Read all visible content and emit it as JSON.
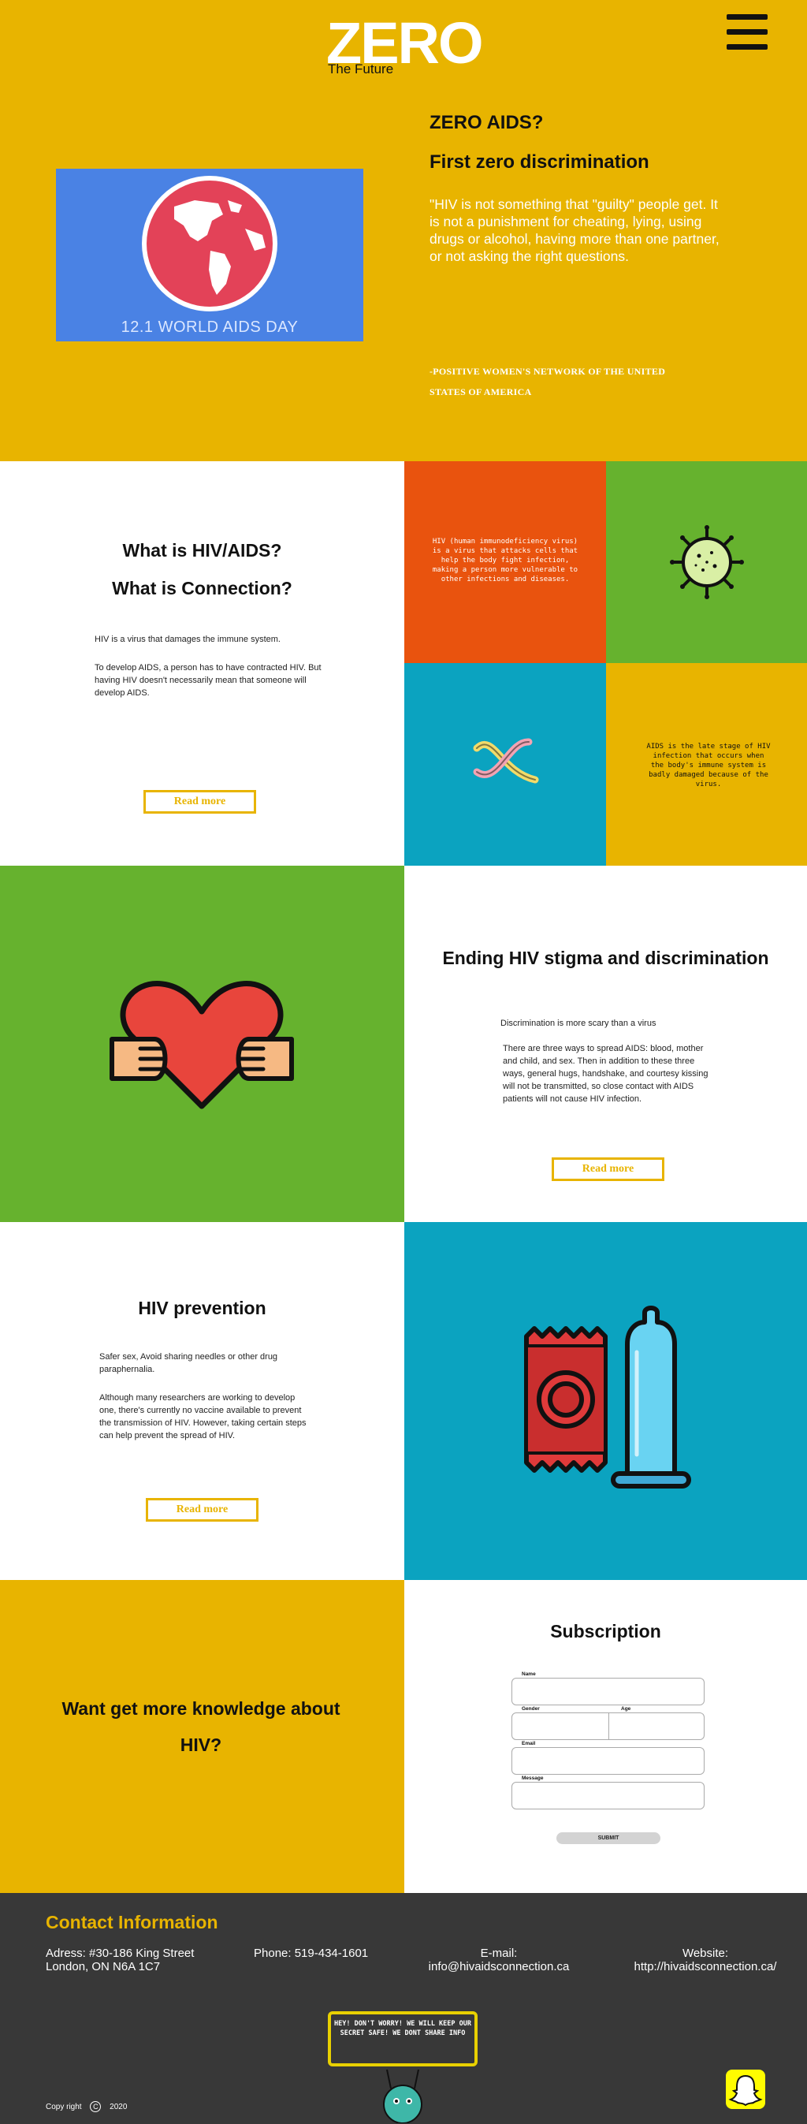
{
  "header": {
    "logo_text": "ZERO",
    "logo_tagline": "The Future",
    "menu_icon": "hamburger-menu-icon"
  },
  "hero": {
    "card_label": "12.1 WORLD AIDS DAY",
    "title_1": "ZERO AIDS?",
    "title_2": "First zero discrimination",
    "quote": "\"HIV is not something that \"guilty\" people get. It is not a punishment for cheating, lying, using drugs or alcohol, having more than one partner, or not asking the right questions.",
    "source": "-POSITIVE WOMEN'S NETWORK OF THE UNITED STATES OF AMERICA"
  },
  "what": {
    "heading_1": "What is HIV/AIDS?",
    "heading_2": "What is Connection?",
    "para_1": "HIV is a virus that damages the immune system.",
    "para_2": "To develop AIDS, a person has to have contracted HIV. But having HIV doesn't necessarily mean that someone will develop AIDS.",
    "read_more": "Read more",
    "tile_hiv_text": "HIV (human immunodeficiency virus) is a virus that attacks cells that help the body fight infection, making a person more vulnerable to other infections and diseases.",
    "tile_aids_text": "AIDS is the late stage of HIV infection that occurs when the body's immune system is badly damaged because of the virus."
  },
  "stigma": {
    "heading": "Ending HIV stigma and discrimination",
    "para_1": "Discrimination is more scary than a virus",
    "para_2": "There are three ways to spread AIDS: blood, mother and child, and sex. Then in addition to these three ways, general hugs, handshake, and courtesy kissing will not be transmitted, so close contact with AIDS patients will not cause HIV infection.",
    "read_more": "Read more"
  },
  "prevention": {
    "heading": "HIV prevention",
    "para_1": "Safer sex, Avoid sharing needles or other drug paraphernalia.",
    "para_2": "Although many researchers are working to develop one, there's currently no vaccine available to prevent the transmission of HIV. However, taking certain steps can help prevent the spread of HIV.",
    "read_more": "Read more"
  },
  "subscription": {
    "question": "Want get more knowledge about HIV?",
    "heading": "Subscription",
    "fields": {
      "name": "Name",
      "gender": "Gender",
      "age": "Age",
      "email": "Email",
      "message": "Message"
    },
    "submit": "SUBMIT"
  },
  "footer": {
    "title": "Contact Information",
    "address": "Adress: #30-186 King Street London, ON N6A 1C7",
    "phone": "Phone: 519-434-1601",
    "email": "E-mail: info@hivaidsconnection.ca",
    "website": "Website: http://hivaidsconnection.ca/",
    "mascot_sign": "HEY! DON'T WORRY! WE WILL KEEP OUR SECRET SAFE! WE DONT SHARE INFO",
    "copyright": "Copy right",
    "year": "2020"
  },
  "colors": {
    "yellow": "#E8B400",
    "orange": "#E9530E",
    "green": "#66B22E",
    "teal": "#0BA3C0",
    "dark": "#383838"
  }
}
